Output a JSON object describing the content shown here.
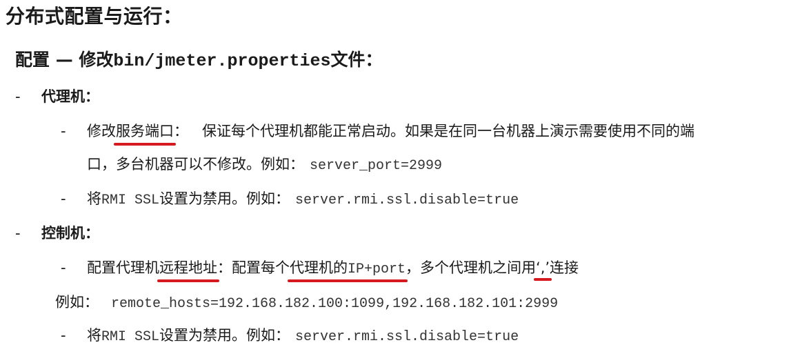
{
  "title": "分布式配置与运行：",
  "config_heading": {
    "prefix": "配置 — 修改",
    "file": "bin/jmeter.properties",
    "suffix": "文件："
  },
  "agent": {
    "dash": "-",
    "heading": "代理机：",
    "item1": {
      "dash": "-",
      "prefix": "修改",
      "highlight": "服务端口",
      "colon": "：",
      "text": "保证每个代理机都能正常启动。如果是在同一台机器上演示需要使用不同的端",
      "cont_text": "口，多台机器可以不修改。例如：",
      "code": "server_port=2999"
    },
    "item2": {
      "dash": "-",
      "prefix": "将",
      "mono": "RMI SSL",
      "text": "设置为禁用。例如：",
      "code": "server.rmi.ssl.disable=true"
    }
  },
  "controller": {
    "dash": "-",
    "heading": "控制机：",
    "item1": {
      "dash": "-",
      "prefix": "配置代理机",
      "highlight1": "远程地址",
      "text1": "：配置每个",
      "highlight2_text": "代理机的",
      "highlight2_mono": "IP+port",
      "text2": "，多个代理机之间用",
      "highlight3": "‘,’",
      "text3": "连接"
    },
    "example": {
      "label": "例如：",
      "code": "remote_hosts=192.168.182.100:1099,192.168.182.101:2999"
    },
    "item2": {
      "dash": "-",
      "prefix": "将",
      "mono": "RMI SSL",
      "text": "设置为禁用。例如：",
      "code": "server.rmi.ssl.disable=true"
    }
  },
  "colors": {
    "text": "#1a1a1a",
    "underline": "#d6191e"
  }
}
